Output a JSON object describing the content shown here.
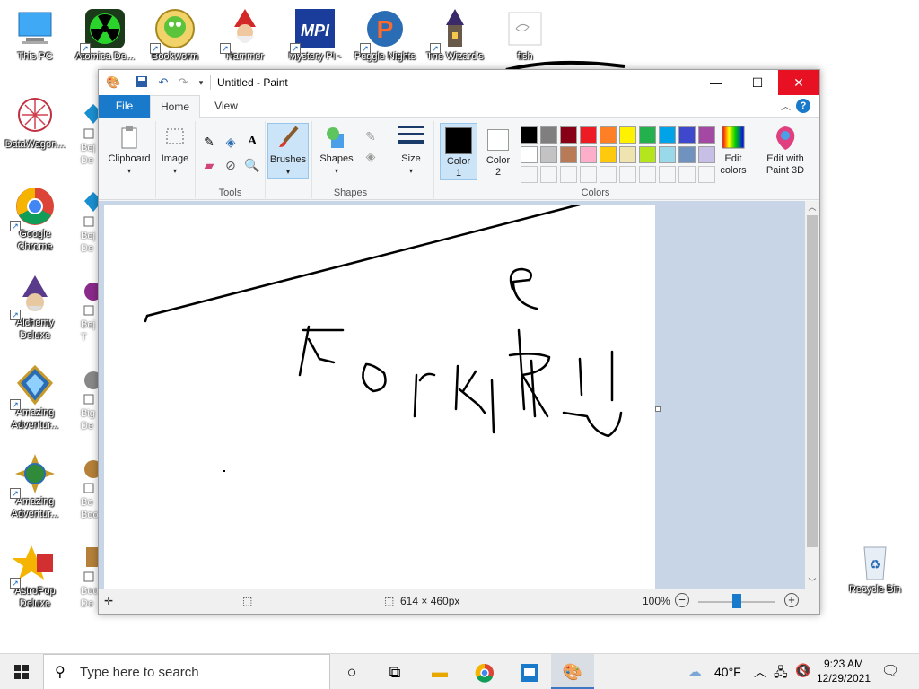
{
  "desktop": {
    "icons": [
      {
        "label": "This PC"
      },
      {
        "label": "DataWagon..."
      },
      {
        "label": "Google Chrome"
      },
      {
        "label": "Alchemy Deluxe"
      },
      {
        "label": "Amazing Adventur..."
      },
      {
        "label": "Amazing Adventur..."
      },
      {
        "label": "AstroPop Deluxe"
      },
      {
        "label": "Atomica De..."
      },
      {
        "label": "Bookworm"
      },
      {
        "label": "Hammer"
      },
      {
        "label": "Mystery PI -"
      },
      {
        "label": "Peggle Nights"
      },
      {
        "label": "The Wizard's"
      },
      {
        "label": "fish"
      },
      {
        "label": "Recycle Bin"
      }
    ],
    "partial_labels": [
      "Bej De",
      "Bej De",
      "Bej T",
      "Big De",
      "Bo Boo",
      "Boo De"
    ]
  },
  "paint": {
    "title": "Untitled - Paint",
    "tabs": {
      "file": "File",
      "home": "Home",
      "view": "View"
    },
    "ribbon": {
      "clipboard": "Clipboard",
      "image": "Image",
      "tools": "Tools",
      "brushes": "Brushes",
      "shapes": "Shapes",
      "shapes_group": "Shapes",
      "size": "Size",
      "color1": "Color\n1",
      "color1_a": "Color",
      "color1_b": "1",
      "color2_a": "Color",
      "color2_b": "2",
      "colors_group": "Colors",
      "edit_colors_a": "Edit",
      "edit_colors_b": "colors",
      "edit_3d_a": "Edit with",
      "edit_3d_b": "Paint 3D"
    },
    "palette_row1": [
      "#000000",
      "#7f7f7f",
      "#880015",
      "#ed1c24",
      "#ff7f27",
      "#fff200",
      "#22b14c",
      "#00a2e8",
      "#3f48cc",
      "#a349a4"
    ],
    "palette_row2": [
      "#ffffff",
      "#c3c3c3",
      "#b97a57",
      "#ffaec9",
      "#ffc90e",
      "#efe4b0",
      "#b5e61d",
      "#99d9ea",
      "#7092be",
      "#c8bfe7"
    ],
    "color1": "#000000",
    "color2": "#ffffff",
    "status": {
      "canvas_size": "614 × 460px",
      "zoom": "100%"
    },
    "zoom_level": 1.0
  },
  "taskbar": {
    "search_placeholder": "Type here to search",
    "weather": "40°F",
    "time": "9:23 AM",
    "date": "12/29/2021"
  }
}
